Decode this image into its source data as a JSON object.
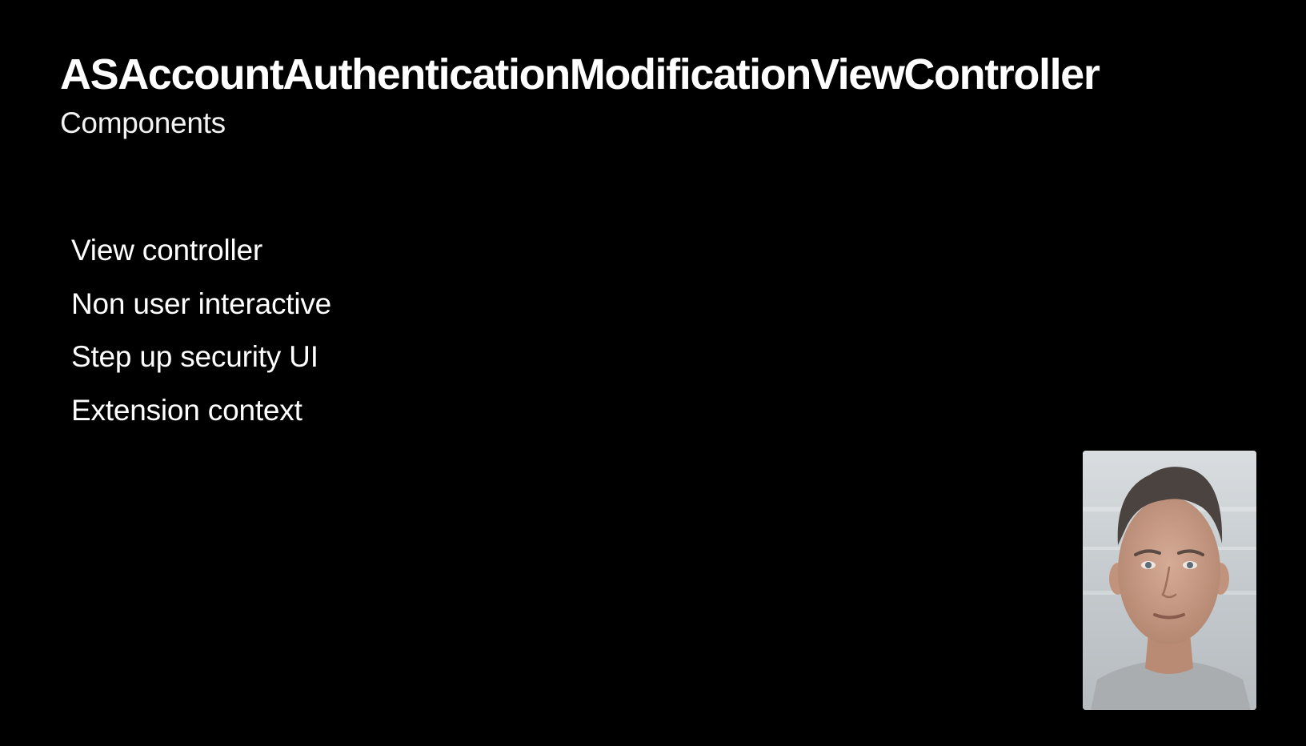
{
  "slide": {
    "title": "ASAccountAuthenticationModificationViewController",
    "subtitle": "Components",
    "bullets": [
      "View controller",
      "Non user interactive",
      "Step up security UI",
      "Extension context"
    ]
  },
  "presenter_video": {
    "icon": "presenter-video-icon",
    "depicts": "presenter headshot"
  },
  "colors": {
    "background": "#000000",
    "text": "#ffffff"
  }
}
